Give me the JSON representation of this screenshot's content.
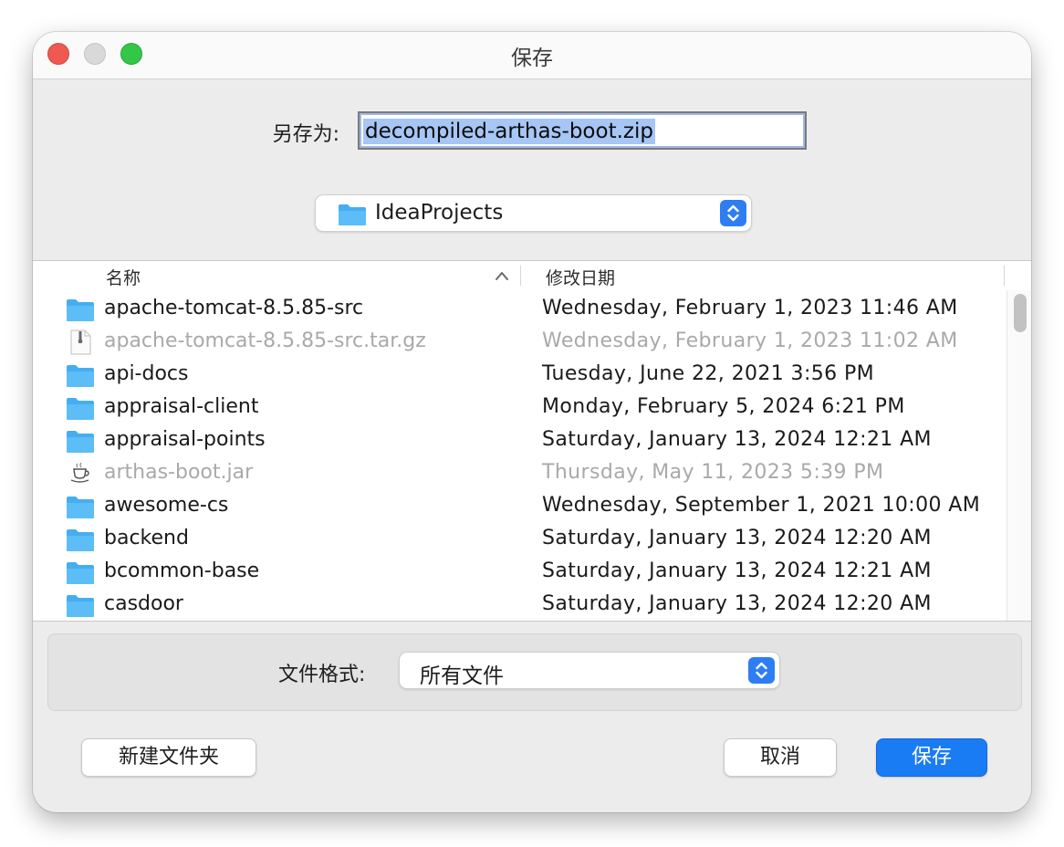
{
  "window": {
    "title": "保存"
  },
  "save_as": {
    "label": "另存为:",
    "value": "decompiled-arthas-boot.zip"
  },
  "location": {
    "folder": "IdeaProjects",
    "icon": "folder-icon"
  },
  "columns": {
    "name": "名称",
    "date": "修改日期"
  },
  "files": [
    {
      "name": "apache-tomcat-8.5.85-src",
      "date": "Wednesday, February 1, 2023 11:46 AM",
      "kind": "folder",
      "enabled": true
    },
    {
      "name": "apache-tomcat-8.5.85-src.tar.gz",
      "date": "Wednesday, February 1, 2023 11:02 AM",
      "kind": "archive",
      "enabled": false
    },
    {
      "name": "api-docs",
      "date": "Tuesday, June 22, 2021 3:56 PM",
      "kind": "folder",
      "enabled": true
    },
    {
      "name": "appraisal-client",
      "date": "Monday, February 5, 2024 6:21 PM",
      "kind": "folder",
      "enabled": true
    },
    {
      "name": "appraisal-points",
      "date": "Saturday, January 13, 2024 12:21 AM",
      "kind": "folder",
      "enabled": true
    },
    {
      "name": "arthas-boot.jar",
      "date": "Thursday, May 11, 2023 5:39 PM",
      "kind": "jar",
      "enabled": false
    },
    {
      "name": "awesome-cs",
      "date": "Wednesday, September 1, 2021 10:00 AM",
      "kind": "folder",
      "enabled": true
    },
    {
      "name": "backend",
      "date": "Saturday, January 13, 2024 12:20 AM",
      "kind": "folder",
      "enabled": true
    },
    {
      "name": "bcommon-base",
      "date": "Saturday, January 13, 2024 12:21 AM",
      "kind": "folder",
      "enabled": true
    },
    {
      "name": "casdoor",
      "date": "Saturday, January 13, 2024 12:20 AM",
      "kind": "folder",
      "enabled": true
    }
  ],
  "file_format": {
    "label": "文件格式:",
    "value": "所有文件"
  },
  "buttons": {
    "new_folder": "新建文件夹",
    "cancel": "取消",
    "save": "保存"
  },
  "colors": {
    "accent": "#1a7cf4",
    "folder_blue": "#45aef2",
    "selection": "#a6c6f5"
  }
}
